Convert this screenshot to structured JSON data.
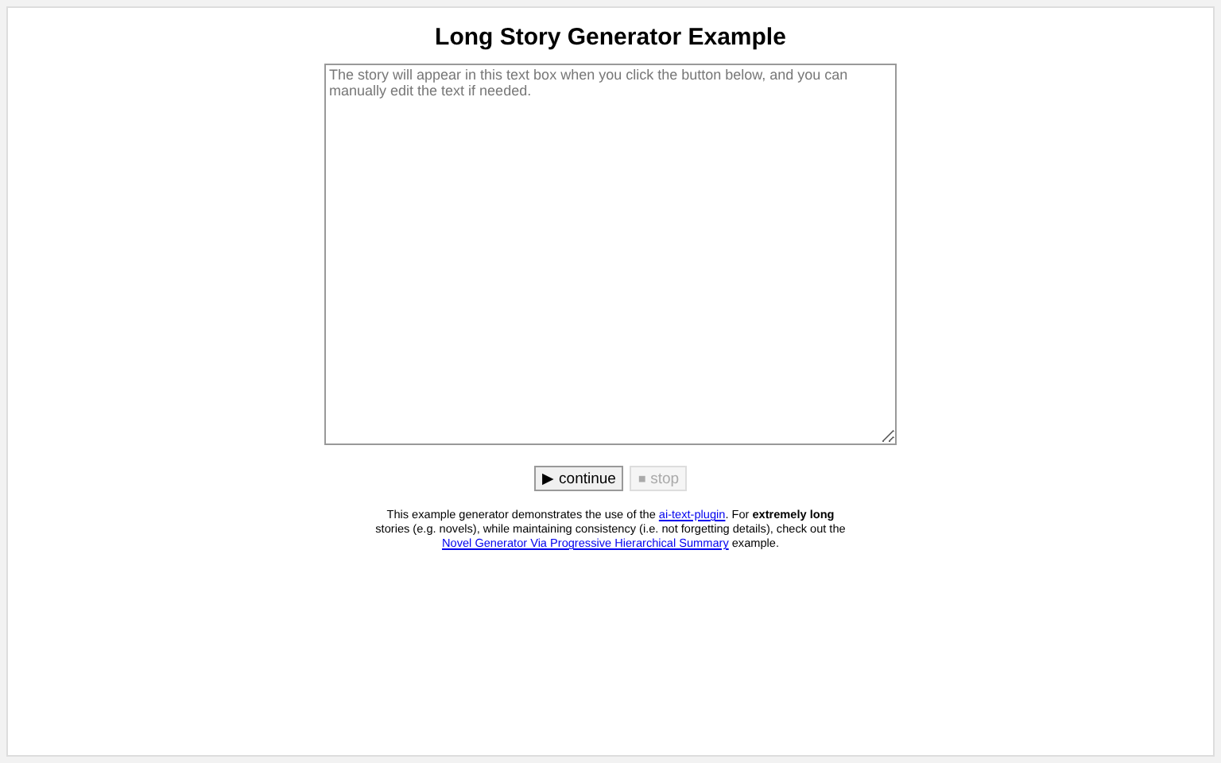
{
  "title": "Long Story Generator Example",
  "story_box": {
    "placeholder": "The story will appear in this text box when you click the button below, and you can manually edit the text if needed."
  },
  "buttons": [
    {
      "label": "▶ continue",
      "disabled": false
    },
    {
      "label": "⏹ stop",
      "disabled": true
    }
  ],
  "description": [
    {
      "kind": "text",
      "text": "This example generator demonstrates the use of the "
    },
    {
      "kind": "link",
      "text": "ai-text-plugin"
    },
    {
      "kind": "text",
      "text": ". For **extremely long** stories (e.g. novels), while maintaining consistency (i.e. not forgetting details), check out the "
    },
    {
      "kind": "link",
      "text": "Novel Generator Via Progressive Hierarchical Summary"
    },
    {
      "kind": "text",
      "text": " example."
    }
  ]
}
